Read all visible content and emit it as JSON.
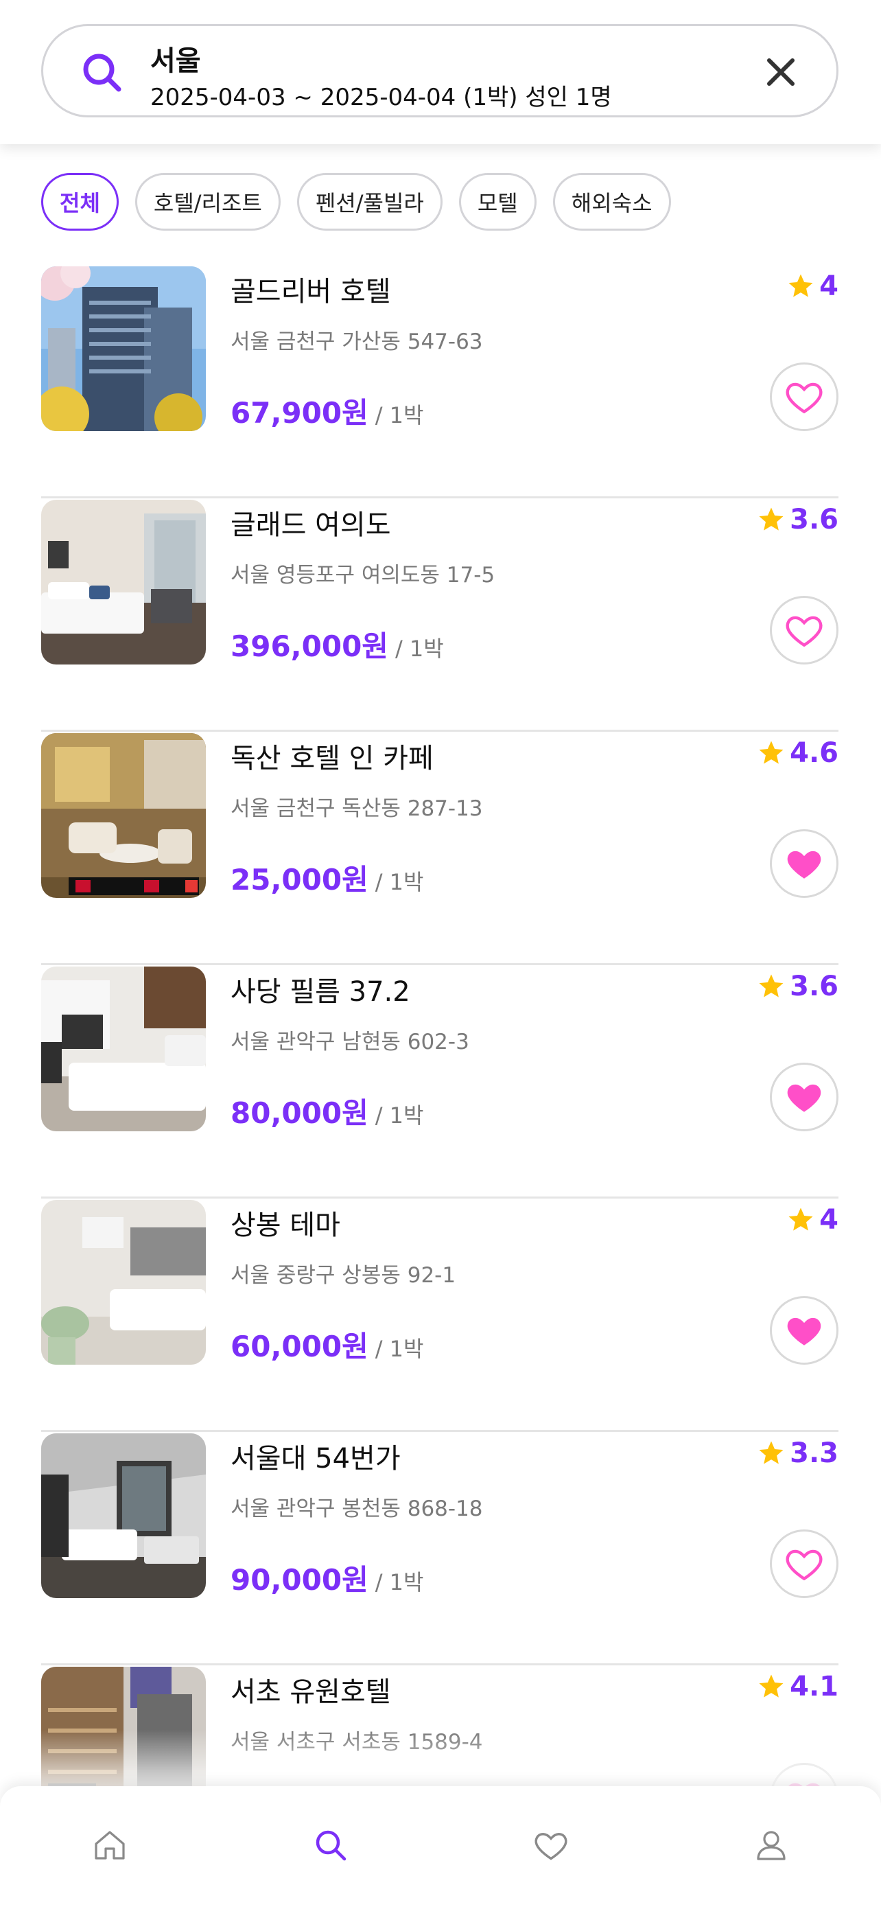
{
  "search": {
    "location": "서울",
    "dates": "2025-04-03 ~ 2025-04-04 (1박) 성인 1명"
  },
  "filters": [
    {
      "label": "전체",
      "active": true
    },
    {
      "label": "호텔/리조트",
      "active": false
    },
    {
      "label": "펜션/풀빌라",
      "active": false
    },
    {
      "label": "모텔",
      "active": false
    },
    {
      "label": "해외숙소",
      "active": false
    }
  ],
  "per_night_label": "/ 1박",
  "colors": {
    "accent": "#7b2ff7",
    "star": "#ffc107",
    "heart": "#ff4fc8"
  },
  "hotels": [
    {
      "name": "골드리버 호텔",
      "address": "서울 금천구 가산동 547-63",
      "price": "67,900원",
      "rating": "4",
      "favorite": false
    },
    {
      "name": "글래드 여의도",
      "address": "서울 영등포구 여의도동 17-5",
      "price": "396,000원",
      "rating": "3.6",
      "favorite": false
    },
    {
      "name": "독산 호텔 인 카페",
      "address": "서울 금천구 독산동 287-13",
      "price": "25,000원",
      "rating": "4.6",
      "favorite": true
    },
    {
      "name": "사당 필름 37.2",
      "address": "서울 관악구 남현동 602-3",
      "price": "80,000원",
      "rating": "3.6",
      "favorite": true
    },
    {
      "name": "상봉 테마",
      "address": "서울 중랑구 상봉동 92-1",
      "price": "60,000원",
      "rating": "4",
      "favorite": true
    },
    {
      "name": "서울대 54번가",
      "address": "서울 관악구 봉천동 868-18",
      "price": "90,000원",
      "rating": "3.3",
      "favorite": false
    },
    {
      "name": "서초 유원호텔",
      "address": "서울 서초구 서초동 1589-4",
      "price": "",
      "rating": "4.1",
      "favorite": false
    }
  ],
  "nav": [
    {
      "icon": "home-icon"
    },
    {
      "icon": "search-icon",
      "active": true
    },
    {
      "icon": "heart-icon"
    },
    {
      "icon": "profile-icon"
    }
  ]
}
